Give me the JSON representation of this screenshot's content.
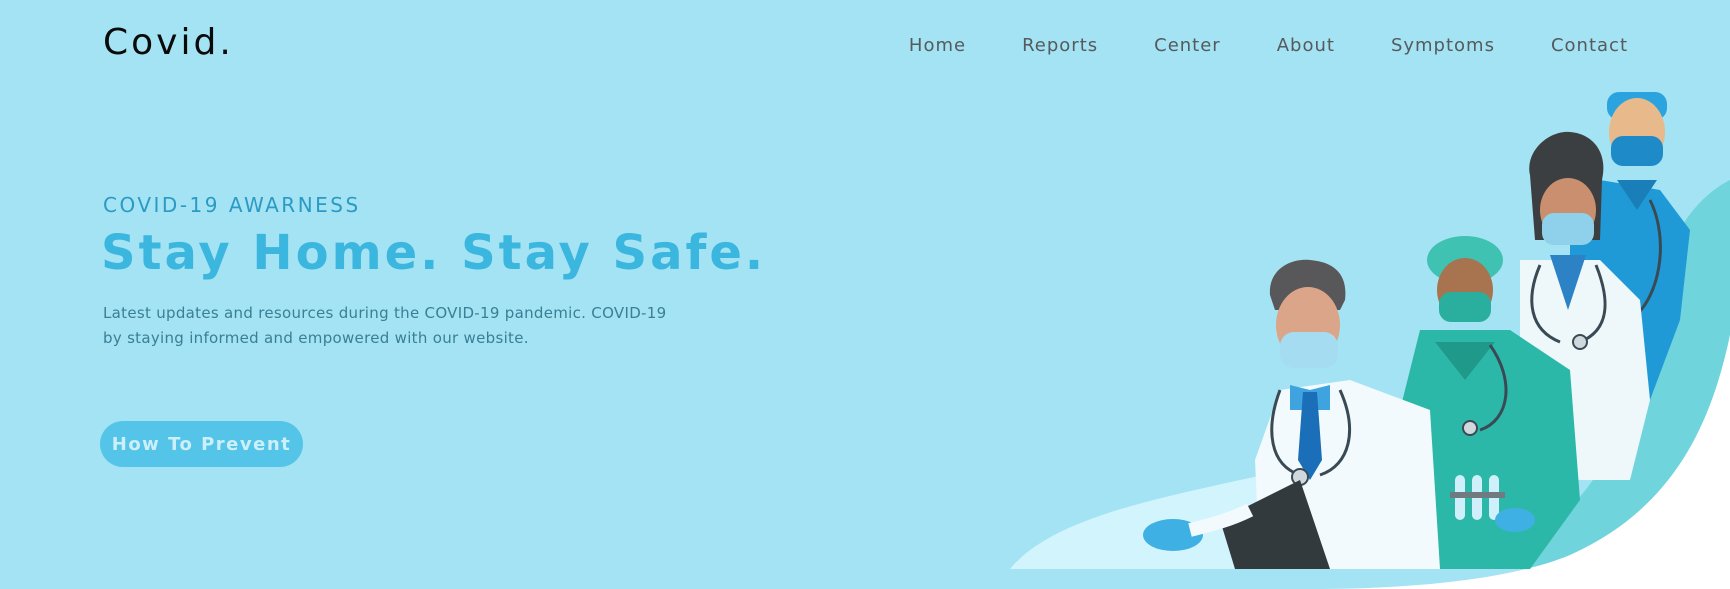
{
  "navbar": {
    "logo": "Covid.",
    "links": [
      "Home",
      "Reports",
      "Center",
      "About",
      "Symptoms",
      "Contact"
    ]
  },
  "hero": {
    "eyebrow": "COVID-19 AWARNESS",
    "headline": "Stay Home. Stay Safe.",
    "description": "Latest updates and resources during the COVID-19 pandemic. COVID-19 by staying informed and empowered with our website.",
    "cta_label": "How To Prevent"
  },
  "colors": {
    "background": "#a3e3f3",
    "accent": "#3bb6de",
    "button": "#54c5e8",
    "nav_text": "#555a5c"
  }
}
